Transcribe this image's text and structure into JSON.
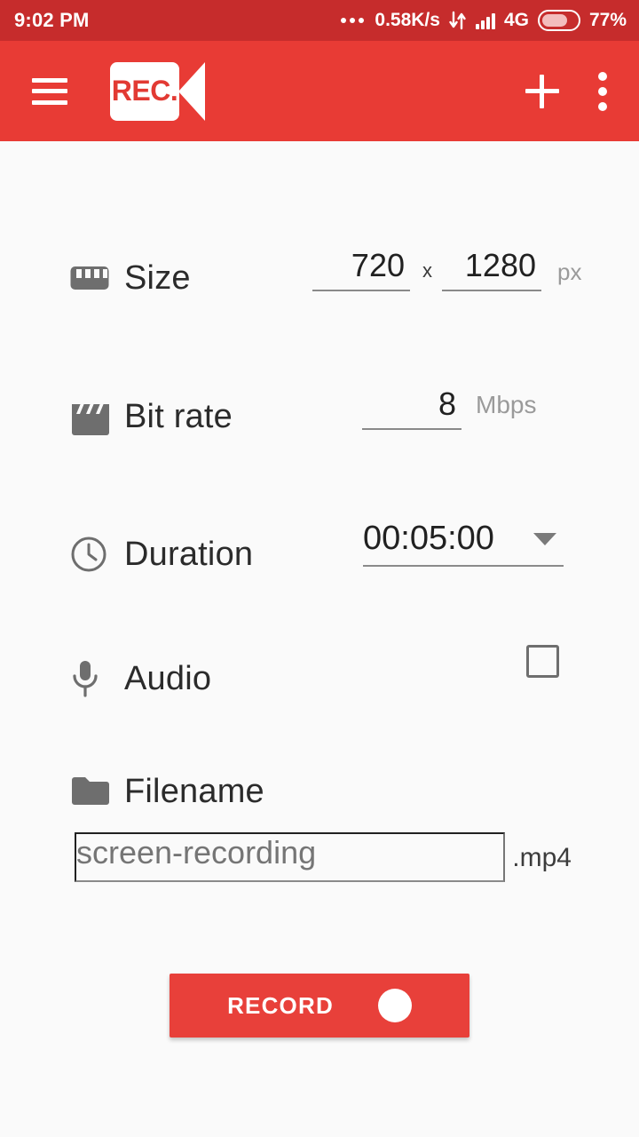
{
  "statusbar": {
    "time": "9:02 PM",
    "overflow_icon": "more-dots-icon",
    "network_speed": "0.58K/s",
    "data_transfer_icon": "data-transfer-arrows-icon",
    "signal_icon": "signal-bars-icon",
    "network_type": "4G",
    "battery_icon": "battery-icon",
    "battery_percent": "77%"
  },
  "appbar": {
    "menu_icon": "hamburger-menu-icon",
    "logo_text": "REC.",
    "logo_lens_icon": "video-camera-lens-icon",
    "add_icon": "plus-icon",
    "overflow_icon": "kebab-menu-icon",
    "background_color": "#e83b35"
  },
  "settings": {
    "size": {
      "icon": "ruler-icon",
      "label": "Size",
      "width_value": "720",
      "separator": "x",
      "height_value": "1280",
      "unit": "px"
    },
    "bitrate": {
      "icon": "clapperboard-icon",
      "label": "Bit rate",
      "value": "8",
      "unit": "Mbps"
    },
    "duration": {
      "icon": "clock-icon",
      "label": "Duration",
      "value": "00:05:00",
      "dropdown_icon": "chevron-down-icon"
    },
    "audio": {
      "icon": "microphone-icon",
      "label": "Audio",
      "checked": false
    },
    "filename": {
      "icon": "folder-icon",
      "label": "Filename",
      "placeholder": "screen-recording",
      "value": "",
      "extension": ".mp4"
    }
  },
  "record_button": {
    "label": "RECORD",
    "dot_icon": "record-dot-icon",
    "color": "#e8403a"
  }
}
